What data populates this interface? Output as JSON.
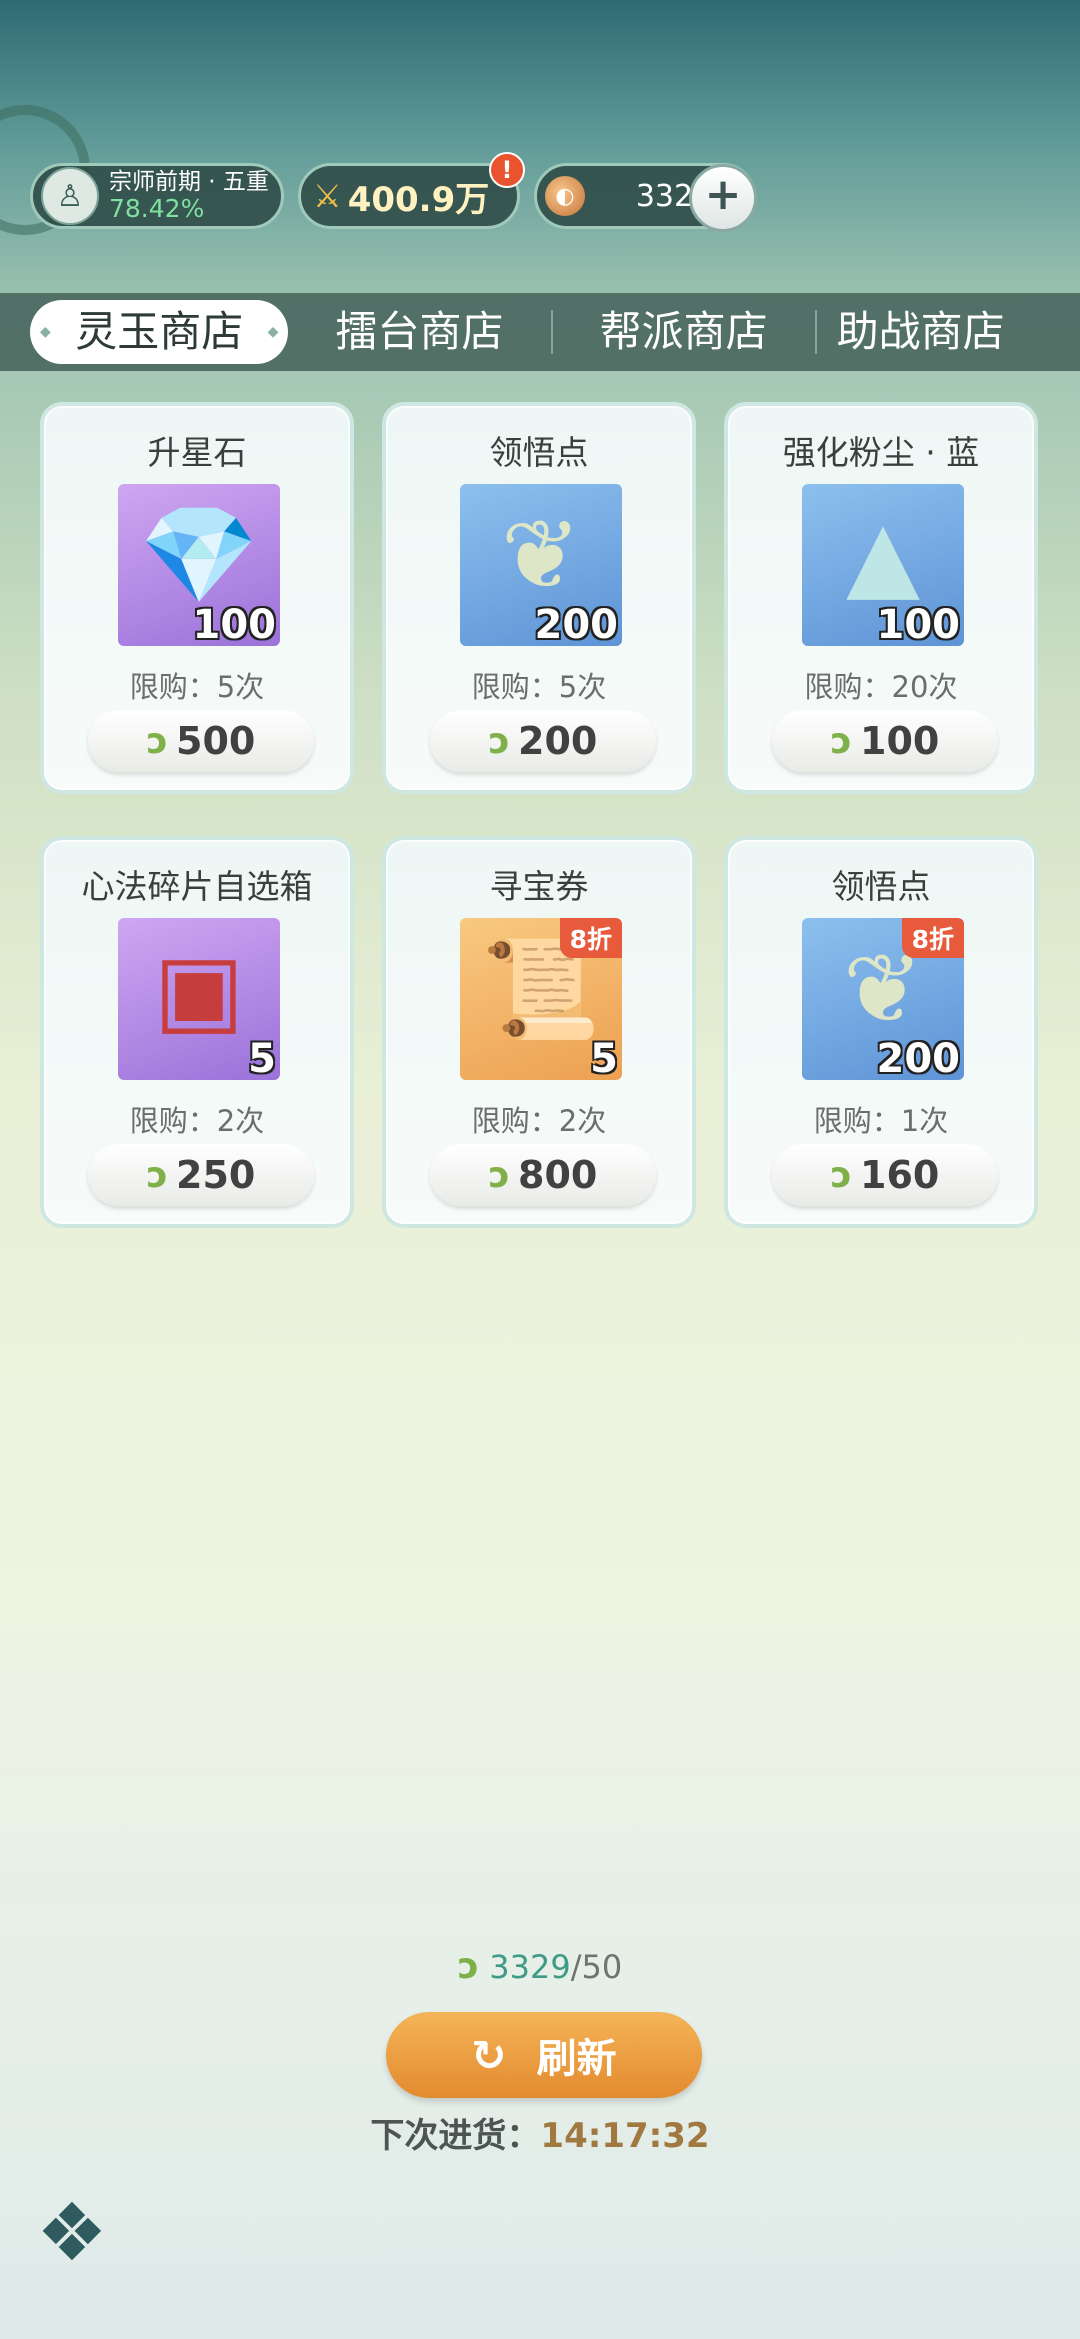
{
  "hud": {
    "rank_title": "宗师前期 · 五重",
    "rank_progress": "78.42%",
    "power": "400.9万",
    "power_alert": "!",
    "coin_amount": "3329",
    "plus": "+"
  },
  "tabs": [
    {
      "label": "灵玉商店",
      "active": true
    },
    {
      "label": "擂台商店",
      "active": false
    },
    {
      "label": "帮派商店",
      "active": false
    },
    {
      "label": "助战商店",
      "active": false
    }
  ],
  "items": [
    {
      "name": "升星石",
      "qty": "100",
      "limit": "限购：5次",
      "price": "500",
      "discount": "",
      "icon": "crystal-icon",
      "bg": "#b48ae6"
    },
    {
      "name": "领悟点",
      "qty": "200",
      "limit": "限购：5次",
      "price": "200",
      "discount": "",
      "icon": "jade-pendant-icon",
      "bg": "#78a9e3"
    },
    {
      "name": "强化粉尘 · 蓝",
      "qty": "100",
      "limit": "限购：20次",
      "price": "100",
      "discount": "",
      "icon": "dust-box-icon",
      "bg": "#78a9e3"
    },
    {
      "name": "心法碎片自选箱",
      "qty": "5",
      "limit": "限购：2次",
      "price": "250",
      "discount": "",
      "icon": "treasure-chest-icon",
      "bg": "#b48ae6"
    },
    {
      "name": "寻宝券",
      "qty": "5",
      "limit": "限购：2次",
      "price": "800",
      "discount": "8折",
      "icon": "scroll-icon",
      "bg": "#f2b468"
    },
    {
      "name": "领悟点",
      "qty": "200",
      "limit": "限购：1次",
      "price": "160",
      "discount": "8折",
      "icon": "jade-pendant-icon",
      "bg": "#78a9e3"
    }
  ],
  "footer": {
    "balance_current": "3329",
    "balance_max": "/50",
    "refresh_label": "刷新",
    "restock_label": "下次进货：",
    "restock_time": "14:17:32"
  }
}
